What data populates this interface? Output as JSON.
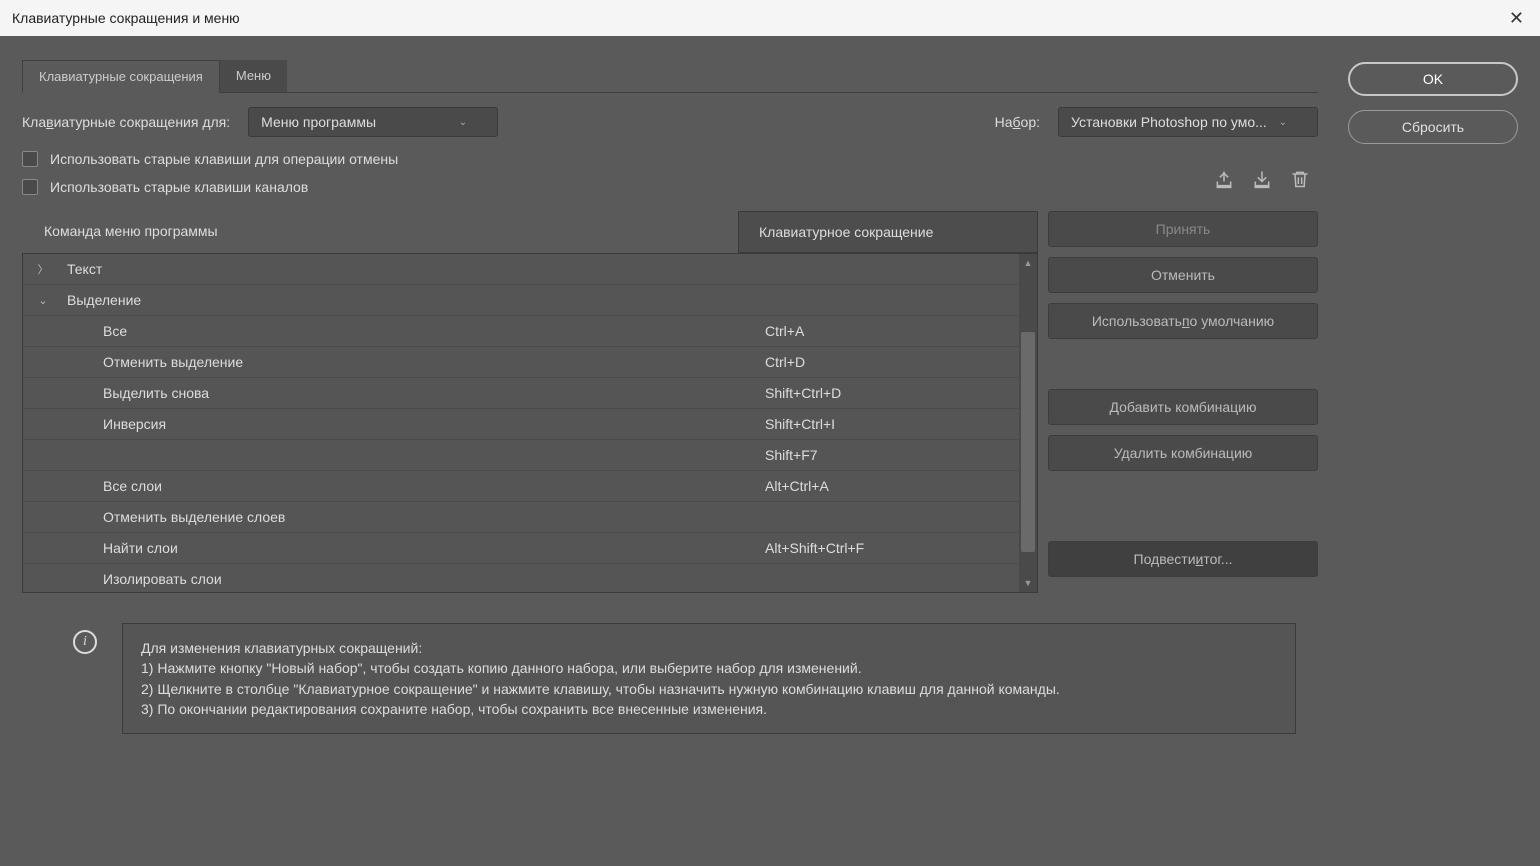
{
  "title": "Клавиатурные сокращения и меню",
  "buttons": {
    "ok": "OK",
    "reset": "Сбросить",
    "accept": "Принять",
    "cancel": "Отменить",
    "use_default": "Использовать по умолчанию",
    "add_shortcut": "Добавить комбинацию",
    "delete_shortcut": "Удалить комбинацию",
    "summarize": "Подвести итог..."
  },
  "tabs": {
    "shortcuts": "Клавиатурные сокращения",
    "menus": "Меню"
  },
  "labels": {
    "shortcuts_for": "Клавиатурные сокращения для:",
    "set": "Набор:",
    "use_legacy_undo": "Использовать старые клавиши для операции отмены",
    "use_legacy_channels": "Использовать старые клавиши каналов"
  },
  "selects": {
    "shortcuts_for_value": "Меню программы",
    "set_value": "Установки Photoshop по умо..."
  },
  "columns": {
    "command": "Команда меню программы",
    "shortcut": "Клавиатурное сокращение"
  },
  "tree": [
    {
      "expand": "〉",
      "name": "Текст",
      "shortcut": "",
      "indent": false
    },
    {
      "expand": "⌄",
      "name": "Выделение",
      "shortcut": "",
      "indent": false
    },
    {
      "expand": "",
      "name": "Все",
      "shortcut": "Ctrl+A",
      "indent": true
    },
    {
      "expand": "",
      "name": "Отменить выделение",
      "shortcut": "Ctrl+D",
      "indent": true
    },
    {
      "expand": "",
      "name": "Выделить снова",
      "shortcut": "Shift+Ctrl+D",
      "indent": true
    },
    {
      "expand": "",
      "name": "Инверсия",
      "shortcut": "Shift+Ctrl+I",
      "indent": true
    },
    {
      "expand": "",
      "name": "",
      "shortcut": "Shift+F7",
      "indent": true
    },
    {
      "expand": "",
      "name": "Все слои",
      "shortcut": "Alt+Ctrl+A",
      "indent": true
    },
    {
      "expand": "",
      "name": "Отменить выделение слоев",
      "shortcut": "",
      "indent": true
    },
    {
      "expand": "",
      "name": "Найти слои",
      "shortcut": "Alt+Shift+Ctrl+F",
      "indent": true
    },
    {
      "expand": "",
      "name": "Изолировать слои",
      "shortcut": "",
      "indent": true
    }
  ],
  "info": {
    "heading": "Для изменения клавиатурных сокращений:",
    "line1": "1) Нажмите кнопку \"Новый набор\", чтобы создать копию данного набора, или выберите набор для изменений.",
    "line2": "2) Щелкните в столбце \"Клавиатурное сокращение\" и нажмите клавишу, чтобы назначить нужную комбинацию клавиш для данной команды.",
    "line3": "3) По окончании редактирования сохраните набор, чтобы сохранить все внесенные изменения."
  }
}
